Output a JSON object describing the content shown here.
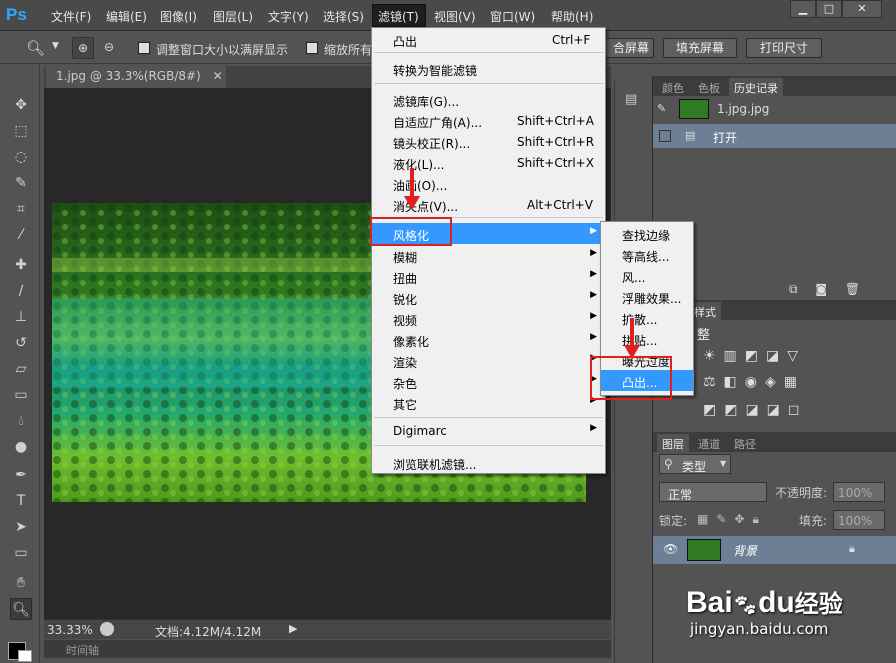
{
  "app": {
    "logo": "Ps"
  },
  "menubar": {
    "items": [
      "文件(F)",
      "编辑(E)",
      "图像(I)",
      "图层(L)",
      "文字(Y)",
      "选择(S)",
      "滤镜(T)",
      "视图(V)",
      "窗口(W)",
      "帮助(H)"
    ],
    "active": "滤镜(T)"
  },
  "options": {
    "resize_label": "调整窗口大小以满屏显示",
    "zoom_all_label": "缩放所有",
    "fit_screen_tail": "合屏幕",
    "fill_screen": "填充屏幕",
    "print_size": "打印尺寸"
  },
  "document": {
    "tab_title": "1.jpg @ 33.3%(RGB/8#)",
    "zoom": "33.33%",
    "doc_size": "文档:4.12M/4.12M",
    "timeline_label": "时间轴"
  },
  "filter_menu": {
    "items": [
      {
        "label": "凸出",
        "shortcut": "Ctrl+F"
      },
      {
        "label": "转换为智能滤镜"
      },
      {
        "label": "滤镜库(G)..."
      },
      {
        "label": "自适应广角(A)...",
        "shortcut": "Shift+Ctrl+A"
      },
      {
        "label": "镜头校正(R)...",
        "shortcut": "Shift+Ctrl+R"
      },
      {
        "label": "液化(L)...",
        "shortcut": "Shift+Ctrl+X"
      },
      {
        "label": "油画(O)..."
      },
      {
        "label": "消失点(V)...",
        "shortcut": "Alt+Ctrl+V"
      },
      {
        "label": "风格化",
        "submenu": true,
        "highlighted": true
      },
      {
        "label": "模糊",
        "submenu": true
      },
      {
        "label": "扭曲",
        "submenu": true
      },
      {
        "label": "锐化",
        "submenu": true
      },
      {
        "label": "视频",
        "submenu": true
      },
      {
        "label": "像素化",
        "submenu": true
      },
      {
        "label": "渲染",
        "submenu": true
      },
      {
        "label": "杂色",
        "submenu": true
      },
      {
        "label": "其它",
        "submenu": true
      },
      {
        "label": "Digimarc",
        "submenu": true
      },
      {
        "label": "浏览联机滤镜..."
      }
    ]
  },
  "stylize_submenu": {
    "items": [
      {
        "label": "查找边缘"
      },
      {
        "label": "等高线..."
      },
      {
        "label": "风..."
      },
      {
        "label": "浮雕效果..."
      },
      {
        "label": "扩散..."
      },
      {
        "label": "拼贴..."
      },
      {
        "label": "曝光过度"
      },
      {
        "label": "凸出...",
        "highlighted": true
      }
    ]
  },
  "history_panel": {
    "tabs": [
      "颜色",
      "色板",
      "历史记录"
    ],
    "active_tab": "历史记录",
    "snapshot": "1.jpg.jpg",
    "states": [
      "打开"
    ]
  },
  "adjust_panel": {
    "tabs": [
      "样式"
    ],
    "label": "整"
  },
  "layers_panel": {
    "tabs": [
      "图层",
      "通道",
      "路径"
    ],
    "filter_kind": "类型",
    "blend_mode": "正常",
    "opacity_label": "不透明度:",
    "opacity_value": "100%",
    "lock_label": "锁定:",
    "fill_label": "填充:",
    "fill_value": "100%",
    "layers": [
      {
        "name": "背景"
      }
    ]
  },
  "watermark": {
    "brand": "Bai",
    "brand2": "du",
    "brand3": "经验",
    "url": "jingyan.baidu.com"
  },
  "colors": {
    "highlight": "#3399ff",
    "annotation": "#e02020",
    "ps_blue": "#31a8ff"
  }
}
